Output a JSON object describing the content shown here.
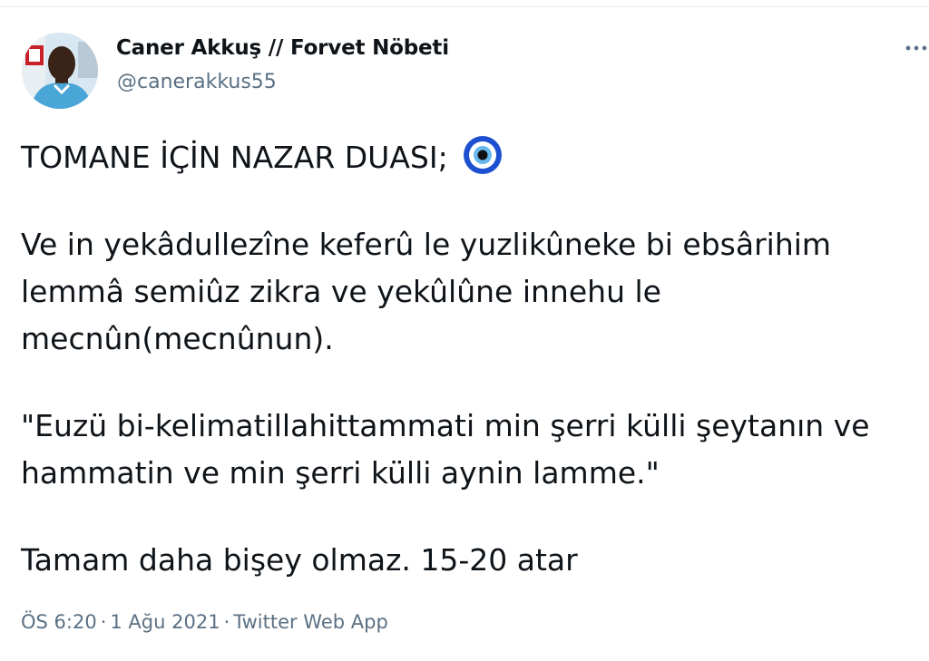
{
  "author": {
    "name": "Caner Akkuş // Forvet Nöbeti",
    "handle": "@canerakkus55"
  },
  "tweet": {
    "title": "TOMANE İÇİN NAZAR DUASI;",
    "title_emoji": "nazar-boncugu-icon",
    "paragraph_1": "Ve in yekâdullezîne keferû le yuzlikûneke bi ebsârihim lemmâ semiûz zikra ve yekûlûne innehu le mecnûn(mecnûnun).",
    "paragraph_2": "\"Euzü bi-kelimatillahittammati min şerri külli şeytanın ve hammatin ve min şerri külli aynin lamme.\"",
    "paragraph_3": "Tamam daha bişey olmaz. 15-20 atar"
  },
  "meta": {
    "time": "ÖS 6:20",
    "separator": "·",
    "date": "1 Ağu 2021",
    "source": "Twitter Web App"
  },
  "icons": {
    "more": "more-dots-icon",
    "avatar": "profile-photo"
  },
  "colors": {
    "text_primary": "#0f1419",
    "text_secondary": "#5b7083",
    "evil_eye_blue": "#1d4fd1"
  }
}
